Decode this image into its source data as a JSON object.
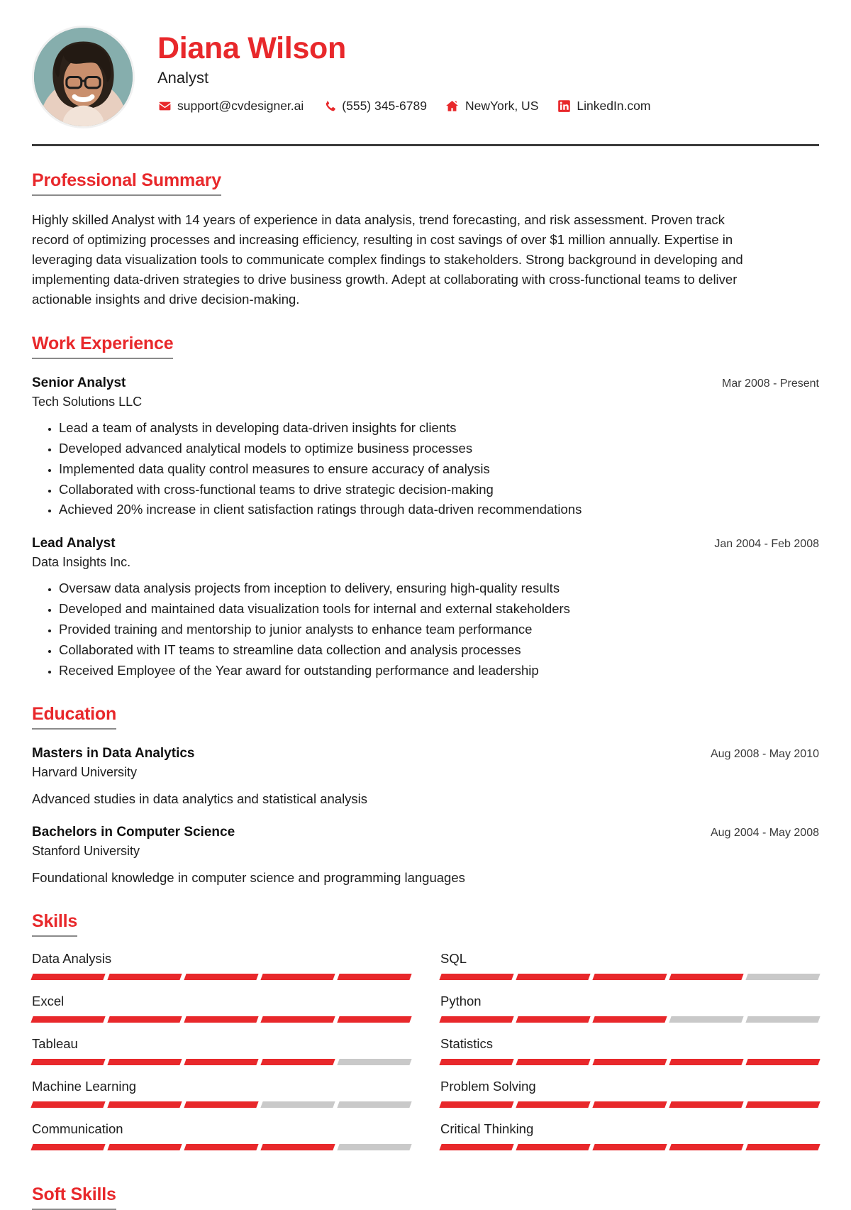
{
  "theme": {
    "accent": "#e8282b",
    "text": "#1d1d1d",
    "muted": "#3a3a3a",
    "bar_empty": "#c9c9c9",
    "rule": "#3b3b3b"
  },
  "header": {
    "name": "Diana Wilson",
    "job_title": "Analyst",
    "avatar_alt": "profile-photo",
    "contacts": [
      {
        "icon": "email-icon",
        "value": "support@cvdesigner.ai"
      },
      {
        "icon": "phone-icon",
        "value": "(555) 345-6789"
      },
      {
        "icon": "home-icon",
        "value": "NewYork, US"
      },
      {
        "icon": "linkedin-icon",
        "value": "LinkedIn.com"
      }
    ]
  },
  "sections": {
    "summary": {
      "title": "Professional Summary",
      "text": "Highly skilled Analyst with 14 years of experience in data analysis, trend forecasting, and risk assessment. Proven track record of optimizing processes and increasing efficiency, resulting in cost savings of over $1 million annually. Expertise in leveraging data visualization tools to communicate complex findings to stakeholders. Strong background in developing and implementing data-driven strategies to drive business growth. Adept at collaborating with cross-functional teams to deliver actionable insights and drive decision-making."
    },
    "work": {
      "title": "Work Experience",
      "entries": [
        {
          "role": "Senior Analyst",
          "org": "Tech Solutions LLC",
          "date": "Mar 2008 - Present",
          "bullets": [
            "Lead a team of analysts in developing data-driven insights for clients",
            "Developed advanced analytical models to optimize business processes",
            "Implemented data quality control measures to ensure accuracy of analysis",
            "Collaborated with cross-functional teams to drive strategic decision-making",
            "Achieved 20% increase in client satisfaction ratings through data-driven recommendations"
          ]
        },
        {
          "role": "Lead Analyst",
          "org": "Data Insights Inc.",
          "date": "Jan 2004 - Feb 2008",
          "bullets": [
            "Oversaw data analysis projects from inception to delivery, ensuring high-quality results",
            "Developed and maintained data visualization tools for internal and external stakeholders",
            "Provided training and mentorship to junior analysts to enhance team performance",
            "Collaborated with IT teams to streamline data collection and analysis processes",
            "Received Employee of the Year award for outstanding performance and leadership"
          ]
        }
      ]
    },
    "education": {
      "title": "Education",
      "entries": [
        {
          "degree": "Masters in Data Analytics",
          "school": "Harvard University",
          "date": "Aug 2008 - May 2010",
          "description": "Advanced studies in data analytics and statistical analysis"
        },
        {
          "degree": "Bachelors in Computer Science",
          "school": "Stanford University",
          "date": "Aug 2004 - May 2008",
          "description": "Foundational knowledge in computer science and programming languages"
        }
      ]
    },
    "skills": {
      "title": "Skills",
      "total_segments": 5,
      "items": [
        {
          "name": "Data Analysis",
          "filled": 5,
          "column": "left"
        },
        {
          "name": "SQL",
          "filled": 4,
          "column": "right"
        },
        {
          "name": "Excel",
          "filled": 5,
          "column": "left"
        },
        {
          "name": "Python",
          "filled": 3,
          "column": "right"
        },
        {
          "name": "Tableau",
          "filled": 4,
          "column": "left"
        },
        {
          "name": "Statistics",
          "filled": 5,
          "column": "right"
        },
        {
          "name": "Machine Learning",
          "filled": 3,
          "column": "left"
        },
        {
          "name": "Problem Solving",
          "filled": 5,
          "column": "right"
        },
        {
          "name": "Communication",
          "filled": 4,
          "column": "left"
        },
        {
          "name": "Critical Thinking",
          "filled": 5,
          "column": "right"
        }
      ]
    },
    "soft_skills": {
      "title": "Soft Skills"
    }
  }
}
